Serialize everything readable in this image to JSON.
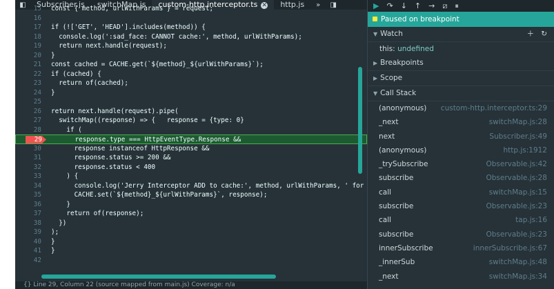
{
  "tabs": [
    {
      "label": "Subscriber.js"
    },
    {
      "label": "switchMap.js"
    },
    {
      "label": "custom-http.interceptor.ts",
      "active": true
    },
    {
      "label": "http.js"
    }
  ],
  "code_lines": [
    {
      "n": "15",
      "t": "const { method, urlWithParams } = request;"
    },
    {
      "n": "16",
      "t": ""
    },
    {
      "n": "17",
      "t": "if (!['GET', 'HEAD'].includes(method)) {"
    },
    {
      "n": "18",
      "t": "  console.log(':sad_face: CANNOT cache:', method, urlWithParams);"
    },
    {
      "n": "19",
      "t": "  return next.handle(request);"
    },
    {
      "n": "20",
      "t": "}"
    },
    {
      "n": "21",
      "t": "const cached = CACHE.get(`${method}_${urlWithParams}`);"
    },
    {
      "n": "22",
      "t": "if (cached) {"
    },
    {
      "n": "23",
      "t": "  return of(cached);"
    },
    {
      "n": "24",
      "t": "}"
    },
    {
      "n": "25",
      "t": ""
    },
    {
      "n": "26",
      "t": "return next.handle(request).pipe("
    },
    {
      "n": "27",
      "t": "  switchMap((response) => {   response = {type: 0}"
    },
    {
      "n": "28",
      "t": "    if ("
    },
    {
      "n": "29",
      "t": "      response.type === HttpEventType.Response &&"
    },
    {
      "n": "30",
      "t": "      response instanceof HttpResponse &&"
    },
    {
      "n": "31",
      "t": "      response.status >= 200 &&"
    },
    {
      "n": "32",
      "t": "      response.status < 400"
    },
    {
      "n": "33",
      "t": "    ) {"
    },
    {
      "n": "34",
      "t": "      console.log('Jerry Interceptor ADD to cache:', method, urlWithParams, ' for response: ', respo"
    },
    {
      "n": "35",
      "t": "      CACHE.set(`${method}_${urlWithParams}`, response);"
    },
    {
      "n": "36",
      "t": "    }"
    },
    {
      "n": "37",
      "t": "    return of(response);"
    },
    {
      "n": "38",
      "t": "  })"
    },
    {
      "n": "39",
      "t": ");"
    },
    {
      "n": "40",
      "t": "}"
    },
    {
      "n": "41",
      "t": "}"
    },
    {
      "n": "42",
      "t": ""
    }
  ],
  "breakpoint_line": "29",
  "status_text": "{}   Line 29, Column 22          (source mapped from main.js)   Coverage: n/a",
  "debugger": {
    "paused_label": "Paused on breakpoint",
    "watch_label": "Watch",
    "watch_var": "this",
    "watch_val": "undefined",
    "breakpoints_label": "Breakpoints",
    "scope_label": "Scope",
    "callstack_label": "Call Stack",
    "stack": [
      {
        "fn": "(anonymous)",
        "loc": "custom-http.interceptor.ts:29"
      },
      {
        "fn": "_next",
        "loc": "switchMap.js:28"
      },
      {
        "fn": "next",
        "loc": "Subscriber.js:49"
      },
      {
        "fn": "(anonymous)",
        "loc": "http.js:1912"
      },
      {
        "fn": "_trySubscribe",
        "loc": "Observable.js:42"
      },
      {
        "fn": "subscribe",
        "loc": "Observable.js:28"
      },
      {
        "fn": "call",
        "loc": "switchMap.js:15"
      },
      {
        "fn": "subscribe",
        "loc": "Observable.js:23"
      },
      {
        "fn": "call",
        "loc": "tap.js:16"
      },
      {
        "fn": "subscribe",
        "loc": "Observable.js:23"
      },
      {
        "fn": "innerSubscribe",
        "loc": "innerSubscribe.js:67"
      },
      {
        "fn": "_innerSub",
        "loc": "switchMap.js:48"
      },
      {
        "fn": "_next",
        "loc": "switchMap.js:34"
      }
    ]
  },
  "colors": {
    "accent": "#26a69a",
    "breakpoint": "#ef5350",
    "background": "#263238"
  }
}
